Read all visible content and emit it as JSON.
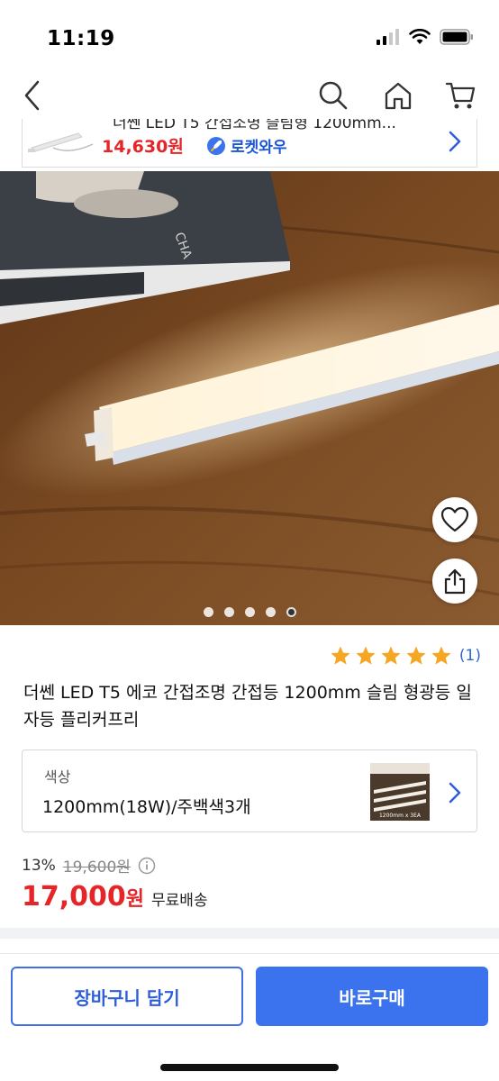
{
  "status_bar": {
    "time": "11:19",
    "icons": [
      "signal-icon",
      "wifi-icon",
      "battery-icon"
    ]
  },
  "nav": {
    "icons": [
      "back-chevron-icon",
      "search-icon",
      "home-icon",
      "cart-icon"
    ]
  },
  "banner": {
    "title": "더쎈 LED T5 간접조명 슬림형 1200mm...",
    "price": "14,630원",
    "badge": "로켓와우",
    "chevron_icon": "chevron-right-icon"
  },
  "gallery": {
    "image_count": 5,
    "active_index": 4,
    "actions": [
      "heart-icon",
      "share-icon"
    ],
    "book_text": "CHA"
  },
  "rating": {
    "stars": 5,
    "count": "(1)",
    "star_color": "#f5a623"
  },
  "product": {
    "title": "더쎈 LED T5 에코 간접조명 간접등 1200mm 슬림 형광등 일자등 플리커프리"
  },
  "option": {
    "label": "색상",
    "value": "1200mm(18W)/주백색3개",
    "thumb_caption": "1200mm x 3EA"
  },
  "price": {
    "discount_rate": "13%",
    "original_price": "19,600원",
    "final_amount": "17,000",
    "final_unit": "원",
    "shipping": "무료배송",
    "accent_color": "#e52528"
  },
  "actions": {
    "cart_label": "장바구니 담기",
    "buy_label": "바로구매",
    "brand_color": "#3b73ee"
  }
}
